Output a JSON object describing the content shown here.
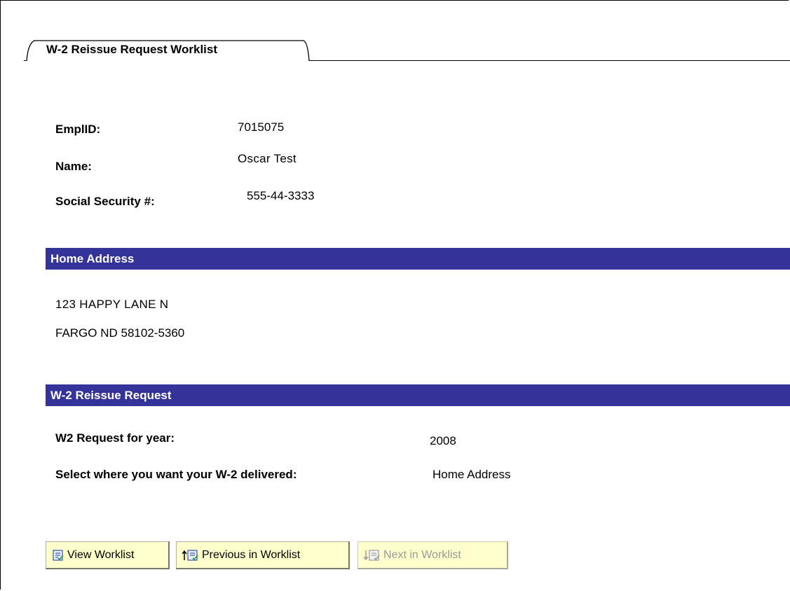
{
  "tab": {
    "label": "W-2 Reissue Request Worklist"
  },
  "employee": {
    "emplid_label": "EmplID:",
    "emplid_value": "7015075",
    "name_label": "Name:",
    "name_value": "Oscar Test",
    "ssn_label": "Social Security #:",
    "ssn_value": "555-44-3333"
  },
  "home_address": {
    "header": "Home Address",
    "line1": "123 HAPPY LANE N",
    "line2": "FARGO ND 58102-5360"
  },
  "reissue_request": {
    "header": "W-2 Reissue Request",
    "year_label": "W2 Request for year:",
    "year_value": "2008",
    "delivery_label": "Select where you want your W-2 delivered:",
    "delivery_value": "Home Address"
  },
  "buttons": {
    "view_worklist": "View Worklist",
    "previous_in_worklist": "Previous in Worklist",
    "next_in_worklist": "Next in Worklist"
  },
  "colors": {
    "section_header_bg": "#333399",
    "section_header_text": "#ffffff",
    "button_bg": "#ffffcc",
    "disabled_text": "#9a9a9a"
  },
  "icons": {
    "worklist": "worklist-icon",
    "previous": "previous-worklist-icon",
    "next": "next-worklist-icon"
  }
}
